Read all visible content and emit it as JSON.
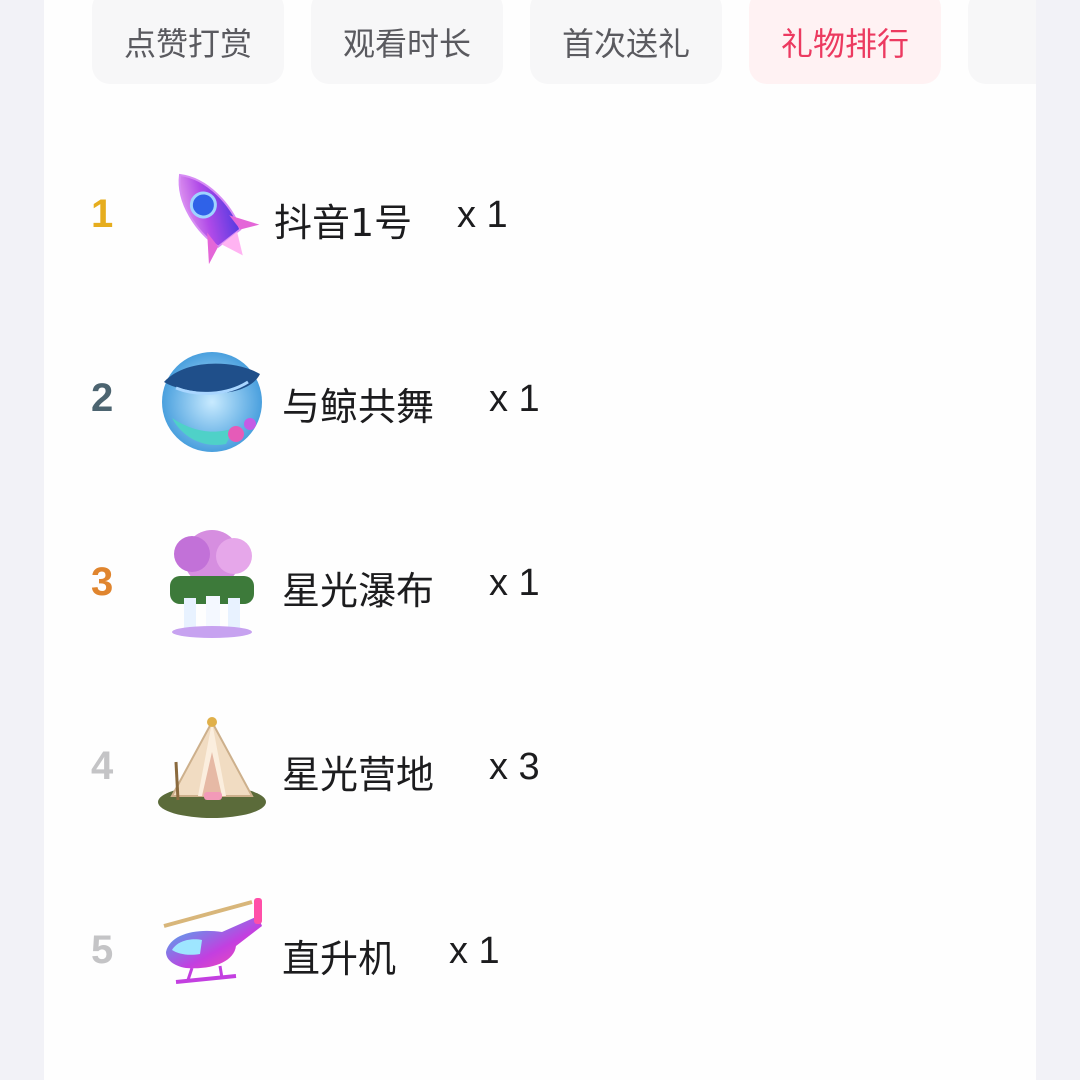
{
  "tabs": [
    {
      "label": "点赞打赏",
      "active": false
    },
    {
      "label": "观看时长",
      "active": false
    },
    {
      "label": "首次送礼",
      "active": false
    },
    {
      "label": "礼物排行",
      "active": true
    }
  ],
  "ranking": [
    {
      "rank": "1",
      "rank_color": "#e6ad1e",
      "icon": "rocket-gift-icon",
      "name": "抖音1号",
      "count": "x 1"
    },
    {
      "rank": "2",
      "rank_color": "#4c6470",
      "icon": "whale-gift-icon",
      "name": "与鲸共舞",
      "count": "x 1"
    },
    {
      "rank": "3",
      "rank_color": "#e0852e",
      "icon": "waterfall-gift-icon",
      "name": "星光瀑布",
      "count": "x 1"
    },
    {
      "rank": "4",
      "rank_color": "#c4c4c6",
      "icon": "camp-tent-gift-icon",
      "name": "星光营地",
      "count": "x 3"
    },
    {
      "rank": "5",
      "rank_color": "#c4c4c6",
      "icon": "helicopter-gift-icon",
      "name": "直升机",
      "count": "x 1"
    }
  ],
  "colors": {
    "active_tab_text": "#ec3a60",
    "active_tab_bg": "#fff2f3",
    "tab_text": "#5a5a5f",
    "tab_bg": "#f7f7f8"
  }
}
